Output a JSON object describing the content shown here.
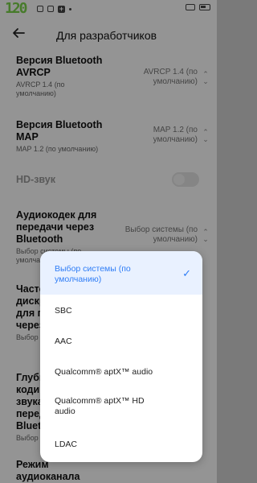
{
  "status_bar": {
    "logo": "120"
  },
  "header": {
    "back_icon": "arrow-left-icon",
    "title": "Для разработчиков"
  },
  "settings": [
    {
      "title": "Версия Bluetooth AVRCP",
      "subtitle": "AVRCP 1.4 (по умолчанию)",
      "value": "AVRCP 1.4 (по умолчанию)"
    },
    {
      "title": "Версия Bluetooth MAP",
      "subtitle": "MAP 1.2 (по умолчанию)",
      "value": "MAP 1.2 (по умолчанию)"
    },
    {
      "title": "HD-звук"
    },
    {
      "title": "Аудиокодек для передачи через Bluetooth",
      "subtitle": "Выбор системы (по умолчанию)",
      "value": "Выбор системы (по умолчанию)"
    },
    {
      "title": "Частота дискретизации для передачи через Bluetooth",
      "subtitle": "Выбор"
    },
    {
      "title": "Глубина кодирования звука при передаче через Bluetooth",
      "subtitle": "Выбор"
    },
    {
      "title": "Режим аудиоканала"
    }
  ],
  "dropdown": {
    "options": [
      {
        "label": "Выбор системы (по умолчанию)",
        "selected": true
      },
      {
        "label": "SBC",
        "selected": false
      },
      {
        "label": "AAC",
        "selected": false
      },
      {
        "label": "Qualcomm® aptX™ audio",
        "selected": false
      },
      {
        "label": "Qualcomm® aptX™ HD audio",
        "selected": false
      },
      {
        "label": "LDAC",
        "selected": false
      }
    ],
    "accent_color": "#2f7df6"
  }
}
